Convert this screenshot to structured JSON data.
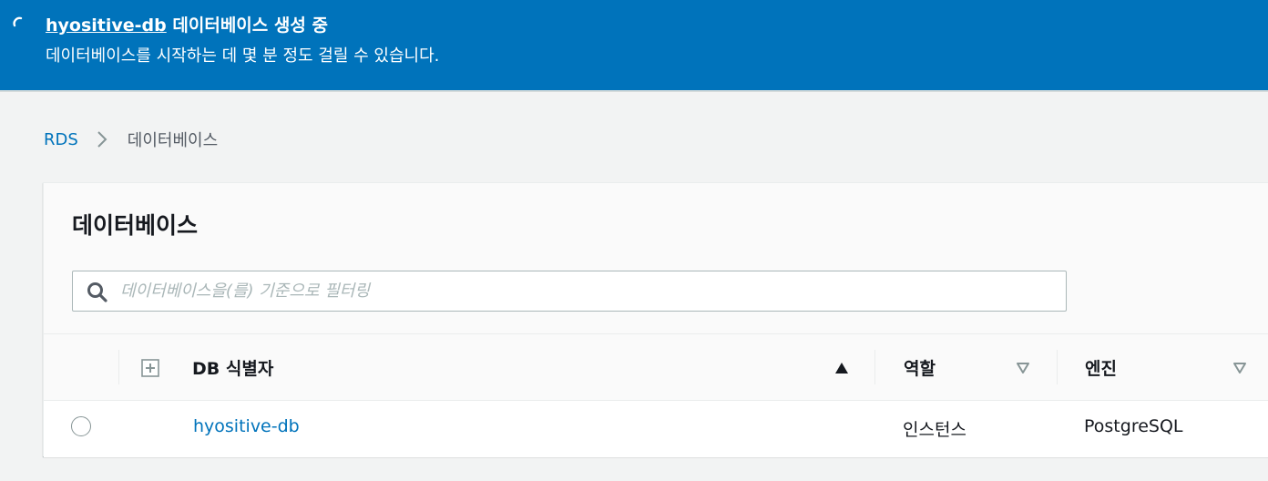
{
  "flash": {
    "db_name": "hyositive-db",
    "status": "데이터베이스 생성 중",
    "message": "데이터베이스를 시작하는 데 몇 분 정도 걸릴 수 있습니다.",
    "icon": "spinner-icon",
    "color": "#0073bb"
  },
  "breadcrumb": {
    "root": "RDS",
    "current": "데이터베이스"
  },
  "panel": {
    "title": "데이터베이스"
  },
  "search": {
    "placeholder": "데이터베이스을(를) 기준으로 필터링",
    "value": ""
  },
  "table": {
    "columns": [
      {
        "label": "DB 식별자",
        "sort": "ascending"
      },
      {
        "label": "역할",
        "sort": "none"
      },
      {
        "label": "엔진",
        "sort": "none"
      }
    ],
    "rows": [
      {
        "selected": false,
        "identifier": "hyositive-db",
        "role": "인스턴스",
        "engine": "PostgreSQL"
      }
    ]
  },
  "colors": {
    "accent": "#0073bb",
    "link": "#0073bb",
    "background": "#f2f3f3"
  }
}
